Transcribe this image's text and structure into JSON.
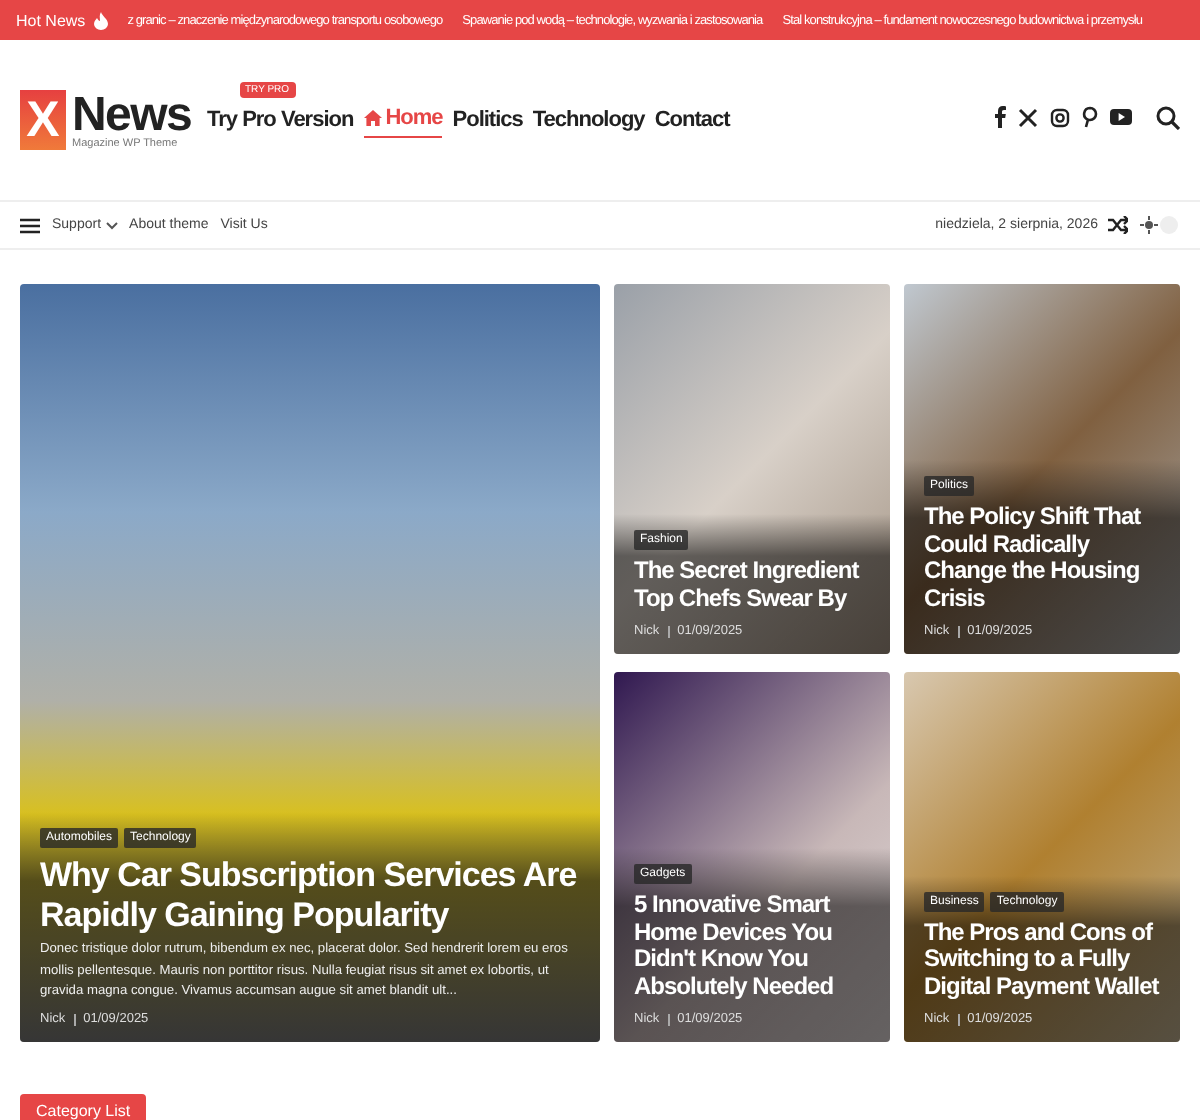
{
  "ticker": {
    "label": "Hot News",
    "items": [
      "z granic – znaczenie międzynarodowego transportu osobowego",
      "Spawanie pod wodą – technologie, wyzwania i zastosowania",
      "Stal konstrukcyjna – fundament nowoczesnego budownictwa i przemysłu"
    ]
  },
  "logo": {
    "letter": "X",
    "name": "News",
    "tagline": "Magazine WP Theme"
  },
  "nav": [
    {
      "label": "Try Pro Version",
      "badge": "TRY PRO",
      "selected": false
    },
    {
      "label": "Home",
      "selected": true
    },
    {
      "label": "Politics",
      "selected": false
    },
    {
      "label": "Technology",
      "selected": false
    },
    {
      "label": "Contact",
      "selected": false
    }
  ],
  "subnav": [
    {
      "label": "Support",
      "dropdown": true
    },
    {
      "label": "About theme",
      "dropdown": false
    },
    {
      "label": "Visit Us",
      "dropdown": false
    }
  ],
  "date": "niedziela, 2 sierpnia, 2026",
  "dark_mode": {
    "on": false
  },
  "cards": [
    {
      "kind": "large",
      "categories": [
        "Automobiles",
        "Technology"
      ],
      "title": "Why Car Subscription Services Are Rapidly Gaining Popularity",
      "excerpt": "Donec tristique dolor rutrum, bibendum ex nec, placerat dolor. Sed hendrerit lorem eu eros mollis pellentesque. Mauris non porttitor risus. Nulla feugiat risus sit amet ex lobortis, ut gravida magna congue. Vivamus accumsan augue sit amet blandit ult...",
      "author": "Nick",
      "date": "01/09/2025"
    },
    {
      "kind": "small",
      "categories": [
        "Fashion"
      ],
      "title": "The Secret Ingredient Top Chefs Swear By",
      "author": "Nick",
      "date": "01/09/2025"
    },
    {
      "kind": "small",
      "categories": [
        "Politics"
      ],
      "title": "The Policy Shift That Could Radically Change the Housing Crisis",
      "author": "Nick",
      "date": "01/09/2025"
    },
    {
      "kind": "small",
      "categories": [
        "Gadgets"
      ],
      "title": "5 Innovative Smart Home Devices You Didn't Know You Absolutely Needed",
      "author": "Nick",
      "date": "01/09/2025"
    },
    {
      "kind": "small",
      "categories": [
        "Business",
        "Technology"
      ],
      "title": "The Pros and Cons of Switching to a Fully Digital Payment Wallet",
      "author": "Nick",
      "date": "01/09/2025"
    }
  ],
  "section_heading": "Category List"
}
